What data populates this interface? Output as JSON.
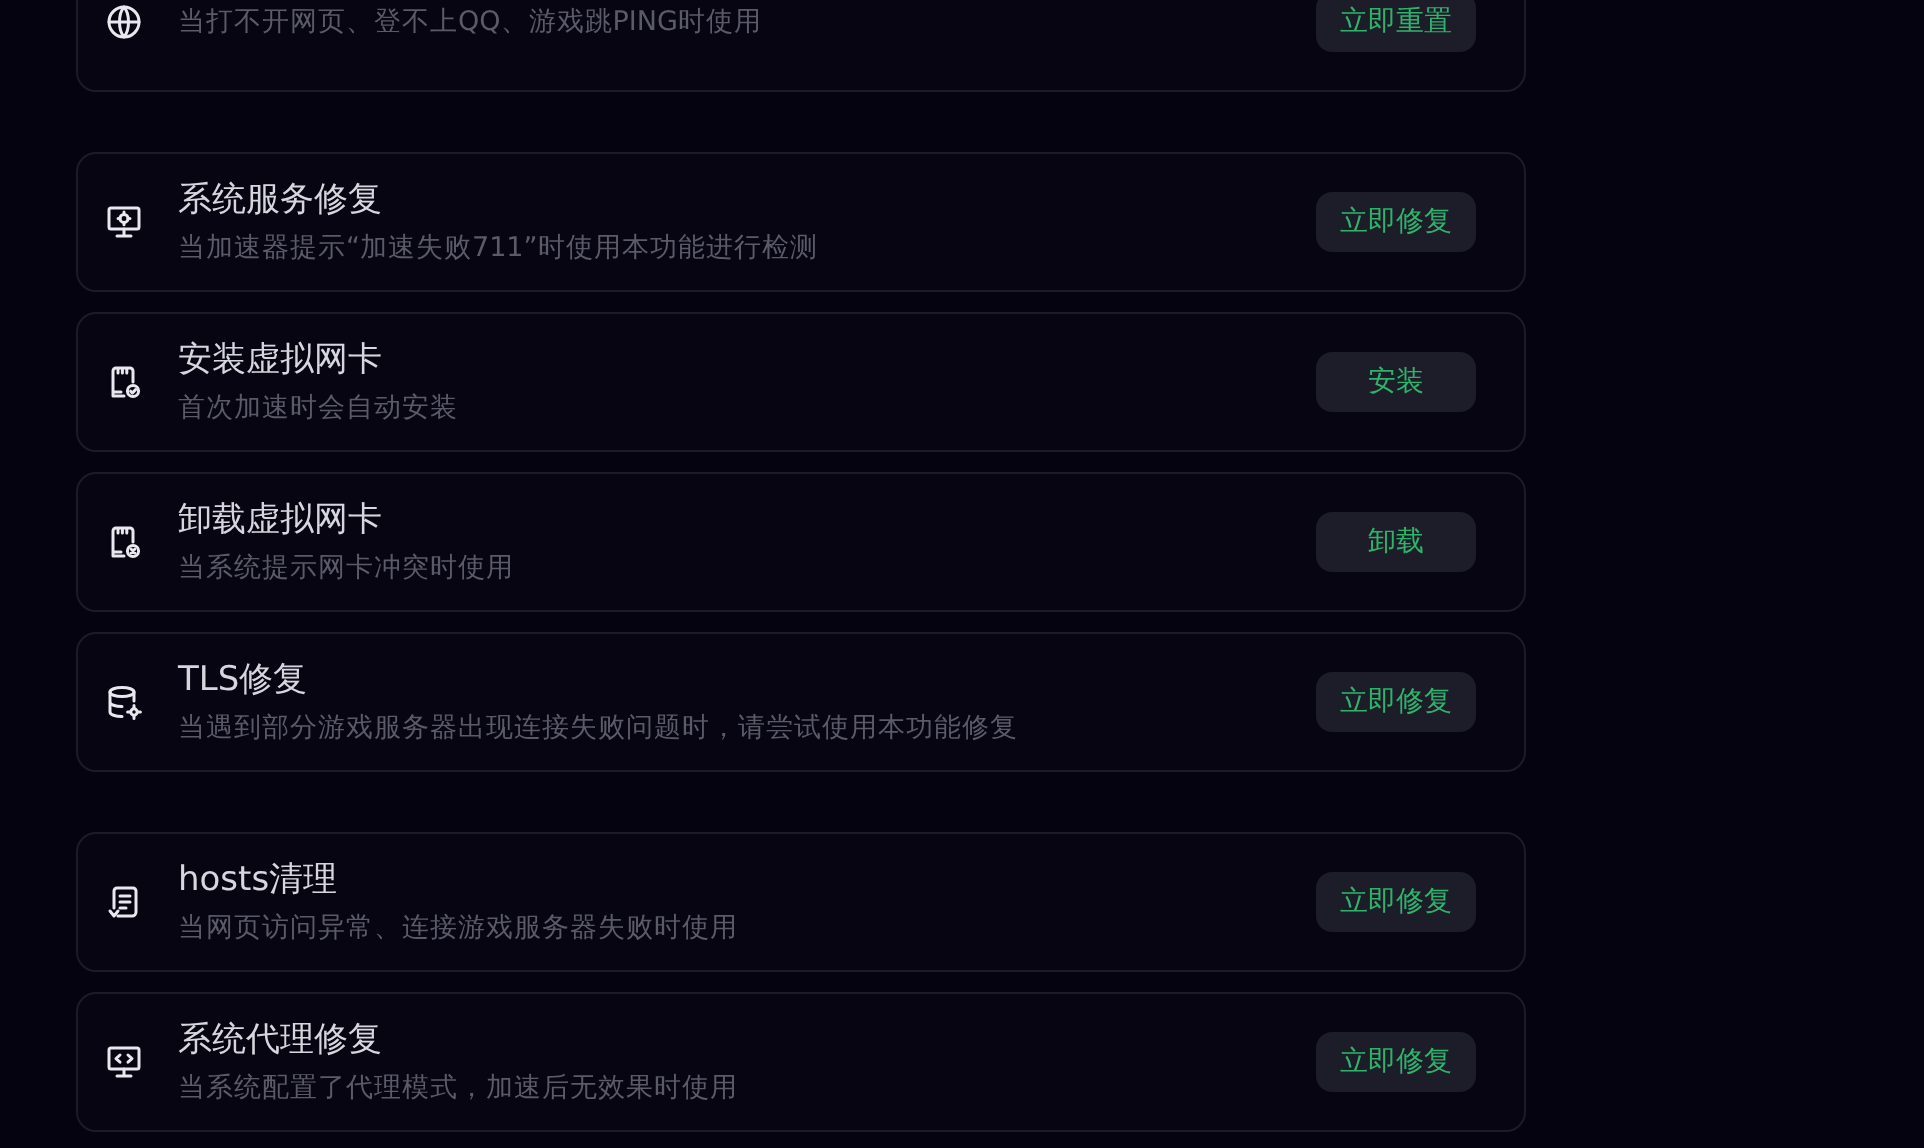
{
  "groups": [
    {
      "items": [
        {
          "kind": "globe",
          "description": "当打不开网页、登不上QQ、游戏跳PING时使用",
          "button": "立即重置"
        }
      ]
    },
    {
      "items": [
        {
          "kind": "monitor-gear",
          "title": "系统服务修复",
          "description": "当加速器提示“加速失败711”时使用本功能进行检测",
          "button": "立即修复"
        },
        {
          "kind": "card-check",
          "title": "安装虚拟网卡",
          "description": "首次加速时会自动安装",
          "button": "安装"
        },
        {
          "kind": "card-x",
          "title": "卸载虚拟网卡",
          "description": "当系统提示网卡冲突时使用",
          "button": "卸载"
        },
        {
          "kind": "database-gear",
          "title": "TLS修复",
          "description": "当遇到部分游戏服务器出现连接失败问题时，请尝试使用本功能修复",
          "button": "立即修复"
        }
      ]
    },
    {
      "items": [
        {
          "kind": "document",
          "title": "hosts清理",
          "description": "当网页访问异常、连接游戏服务器失败时使用",
          "button": "立即修复"
        },
        {
          "kind": "monitor-code",
          "title": "系统代理修复",
          "description": "当系统配置了代理模式，加速后无效果时使用",
          "button": "立即修复"
        }
      ]
    }
  ]
}
